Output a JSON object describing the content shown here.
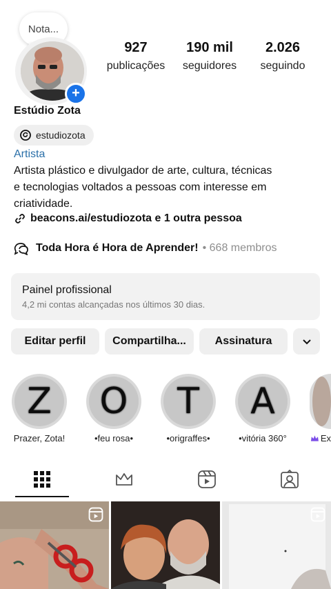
{
  "note": {
    "text": "Nota..."
  },
  "profile": {
    "name": "Estúdio Zota",
    "threads_handle": "estudiozota",
    "category": "Artista",
    "bio_line1": "Artista plástico e divulgador de arte, cultura, técnicas",
    "bio_line2": "e tecnologias voltados a pessoas com interesse em",
    "bio_line3": "criatividade.",
    "link": "beacons.ai/estudiozota e 1 outra pessoa"
  },
  "stats": [
    {
      "value": "927",
      "label": "publicações"
    },
    {
      "value": "190 mil",
      "label": "seguidores"
    },
    {
      "value": "2.026",
      "label": "seguindo"
    }
  ],
  "community": {
    "name": "Toda Hora é Hora de Aprender!",
    "meta": "• 668 membros"
  },
  "panel": {
    "title": "Painel profissional",
    "subtitle": "4,2 mi contas alcançadas nos últimos 30 dias."
  },
  "buttons": {
    "edit": "Editar perfil",
    "share": "Compartilha...",
    "subscribe": "Assinatura"
  },
  "highlights": [
    {
      "letter": "Z",
      "label": "Prazer, Zota!"
    },
    {
      "letter": "O",
      "label": "•feu rosa•"
    },
    {
      "letter": "T",
      "label": "•origraffes•"
    },
    {
      "letter": "A",
      "label": "•vitória 360°"
    },
    {
      "letter": "",
      "label": "Ex"
    }
  ],
  "colors": {
    "accent_blue": "#1a73e8",
    "category_blue": "#2a6fa8",
    "muted": "#8e8e8e",
    "panel_bg": "#f2f2f2",
    "subscribe_crown": "#7b4ee8"
  }
}
